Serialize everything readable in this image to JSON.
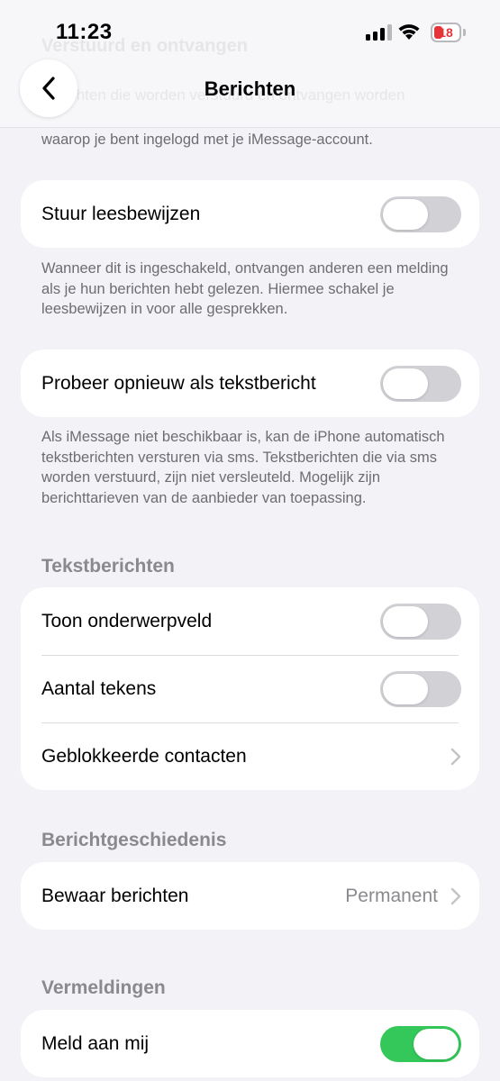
{
  "status_bar": {
    "time": "11:23",
    "battery": "18"
  },
  "nav": {
    "title": "Berichten",
    "ghost_lines": [
      "Verstuurd en ontvangen",
      "Berichten die worden verstuurd en ontvangen worden"
    ]
  },
  "top_footnote_visible": "waarop je bent ingelogd met je iMessage-account.",
  "read_receipts": {
    "label": "Stuur leesbewijzen",
    "on": false,
    "footnote": "Wanneer dit is ingeschakeld, ontvangen anderen een melding als je hun berichten hebt gelezen. Hiermee schakel je leesbewijzen in voor alle gesprekken."
  },
  "send_as_sms": {
    "label": "Probeer opnieuw als tekstbericht",
    "on": false,
    "footnote": "Als iMessage niet beschikbaar is, kan de iPhone automatisch tekstberichten versturen via sms. Tekstberichten die via sms worden verstuurd, zijn niet versleuteld. Mogelijk zijn berichttarieven van de aanbieder van toepassing."
  },
  "text_messages": {
    "header": "Tekstberichten",
    "show_subject": {
      "label": "Toon onderwerpveld",
      "on": false
    },
    "char_count": {
      "label": "Aantal tekens",
      "on": false
    },
    "blocked": {
      "label": "Geblokkeerde contacten"
    }
  },
  "history": {
    "header": "Berichtgeschiedenis",
    "keep": {
      "label": "Bewaar berichten",
      "value": "Permanent"
    }
  },
  "mentions": {
    "header": "Vermeldingen",
    "notify_me": {
      "label": "Meld aan mij",
      "on": true
    }
  },
  "colors": {
    "background": "#f2f2f7",
    "toggle_off": "#d1d1d6",
    "toggle_on": "#34c759",
    "battery_low": "#e5353b"
  }
}
